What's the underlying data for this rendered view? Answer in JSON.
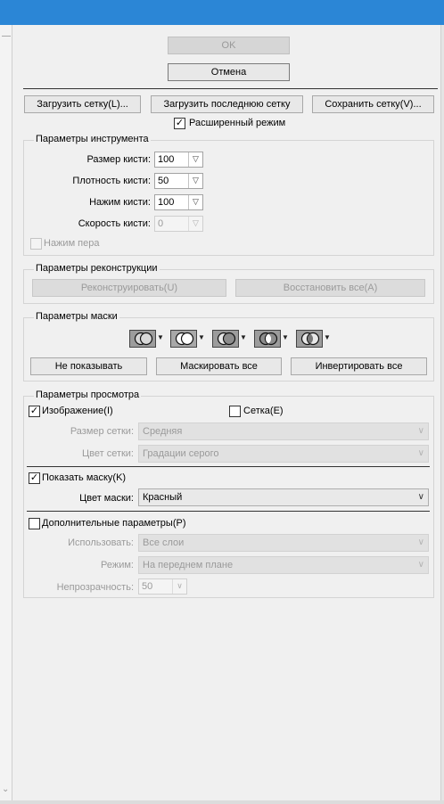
{
  "dialog": {
    "ok_label": "OK",
    "cancel_label": "Отмена",
    "load_mesh_label": "Загрузить сетку(L)...",
    "load_last_mesh_label": "Загрузить последнюю сетку",
    "save_mesh_label": "Сохранить сетку(V)...",
    "advanced_mode": {
      "label": "Расширенный режим",
      "checked": true
    }
  },
  "tool_options": {
    "title": "Параметры инструмента",
    "brush_size": {
      "label": "Размер кисти:",
      "value": "100"
    },
    "brush_density": {
      "label": "Плотность кисти:",
      "value": "50"
    },
    "brush_pressure": {
      "label": "Нажим кисти:",
      "value": "100"
    },
    "brush_rate": {
      "label": "Скорость кисти:",
      "value": "0"
    },
    "stylus_pressure": {
      "label": "Нажим пера",
      "checked": false
    }
  },
  "reconstruct_options": {
    "title": "Параметры реконструкции",
    "reconstruct_label": "Реконструировать(U)",
    "restore_all_label": "Восстановить все(A)"
  },
  "mask_options": {
    "title": "Параметры маски",
    "mode_icons": [
      "replace-selection-icon",
      "add-to-selection-icon",
      "subtract-from-selection-icon",
      "intersect-selection-icon",
      "invert-selection-icon"
    ],
    "none_label": "Не показывать",
    "mask_all_label": "Маскировать все",
    "invert_all_label": "Инвертировать все"
  },
  "view_options": {
    "title": "Параметры просмотра",
    "show_image": {
      "label": "Изображение(I)",
      "checked": true
    },
    "show_mesh": {
      "label": "Сетка(E)",
      "checked": false
    },
    "mesh_size": {
      "label": "Размер сетки:",
      "value": "Средняя"
    },
    "mesh_color": {
      "label": "Цвет сетки:",
      "value": "Градации серого"
    },
    "show_mask": {
      "label": "Показать маску(K)",
      "checked": true
    },
    "mask_color": {
      "label": "Цвет маски:",
      "value": "Красный"
    },
    "show_backdrop": {
      "label": "Дополнительные параметры(P)",
      "checked": false
    },
    "use": {
      "label": "Использовать:",
      "value": "Все слои"
    },
    "mode": {
      "label": "Режим:",
      "value": "На переднем плане"
    },
    "opacity": {
      "label": "Непрозрачность:",
      "value": "50"
    }
  },
  "colors": {
    "titlebar": "#2b86d6",
    "dialog_bg": "#f0f0f0"
  }
}
